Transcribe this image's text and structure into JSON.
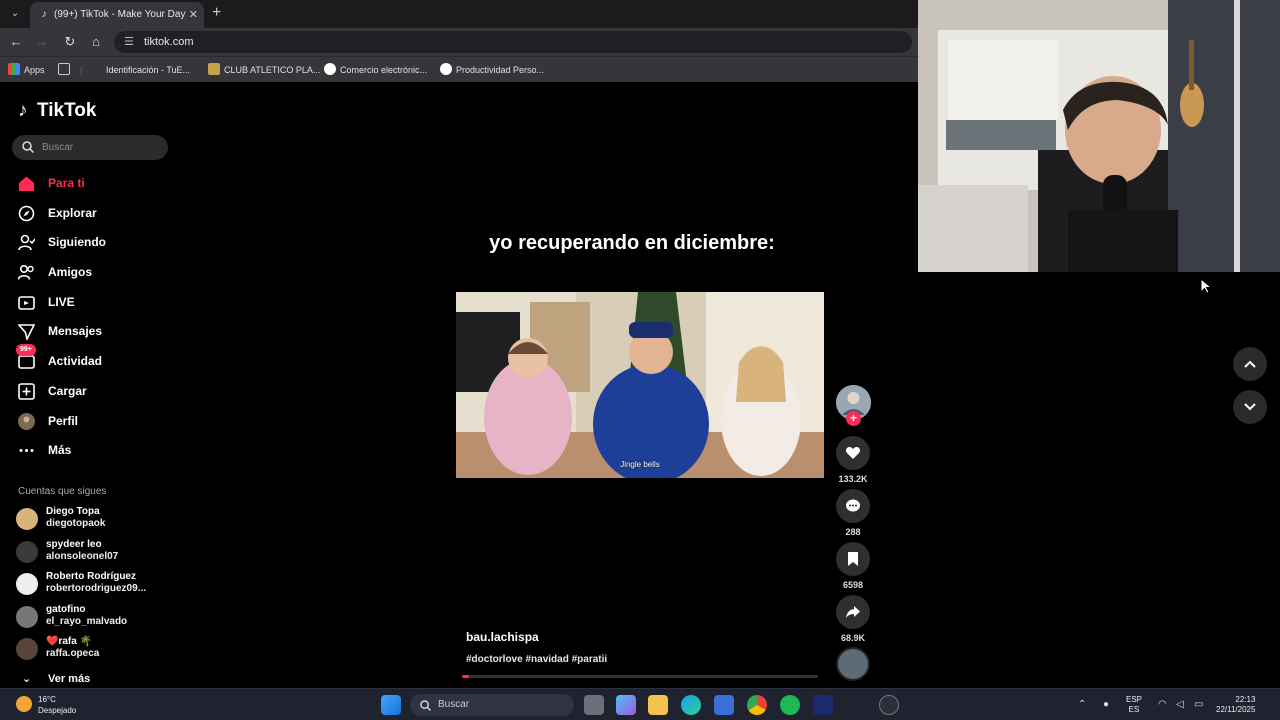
{
  "browser": {
    "tab_title": "(99+) TikTok - Make Your Day",
    "url": "tiktok.com",
    "bookmarks": [
      "Apps",
      "Identificación - TuE...",
      "CLUB ATLETICO PLA...",
      "Comercio electrónic...",
      "Productividad Perso..."
    ]
  },
  "sidebar": {
    "logo": "TikTok",
    "search_placeholder": "Buscar",
    "nav": [
      {
        "label": "Para ti",
        "icon": "home-icon"
      },
      {
        "label": "Explorar",
        "icon": "compass-icon"
      },
      {
        "label": "Siguiendo",
        "icon": "following-icon"
      },
      {
        "label": "Amigos",
        "icon": "friends-icon"
      },
      {
        "label": "LIVE",
        "icon": "live-icon"
      },
      {
        "label": "Mensajes",
        "icon": "messages-icon"
      },
      {
        "label": "Actividad",
        "icon": "activity-icon",
        "badge": "99+"
      },
      {
        "label": "Cargar",
        "icon": "upload-icon"
      },
      {
        "label": "Perfil",
        "icon": "profile-avatar"
      },
      {
        "label": "Más",
        "icon": "more-icon"
      }
    ],
    "following_title": "Cuentas que sigues",
    "following": [
      {
        "name": "Diego Topa",
        "handle": "diegotopaok"
      },
      {
        "name": "spydeer leo",
        "handle": "alonsoleonel07"
      },
      {
        "name": "Roberto Rodríguez",
        "handle": "robertorodriguez09..."
      },
      {
        "name": "gatofino",
        "handle": "el_rayo_malvado"
      },
      {
        "name": "❤️rafa 🌴",
        "handle": "raffa.opeca"
      }
    ],
    "see_more": "Ver más"
  },
  "video": {
    "caption": "yo recuperando en diciembre:",
    "subtitle": "Jingle bells",
    "author": "bau.lachispa",
    "tags": "#doctorlove #navidad  #paratii",
    "progress": 0.02,
    "likes": "133.2K",
    "comments": "288",
    "saves": "6598",
    "shares": "68.9K"
  },
  "taskbar": {
    "temp": "16°C",
    "weather": "Despejado",
    "search": "Buscar",
    "lang1": "ESP",
    "lang2": "ES",
    "time": "22:13",
    "date": "22/11/2025"
  }
}
